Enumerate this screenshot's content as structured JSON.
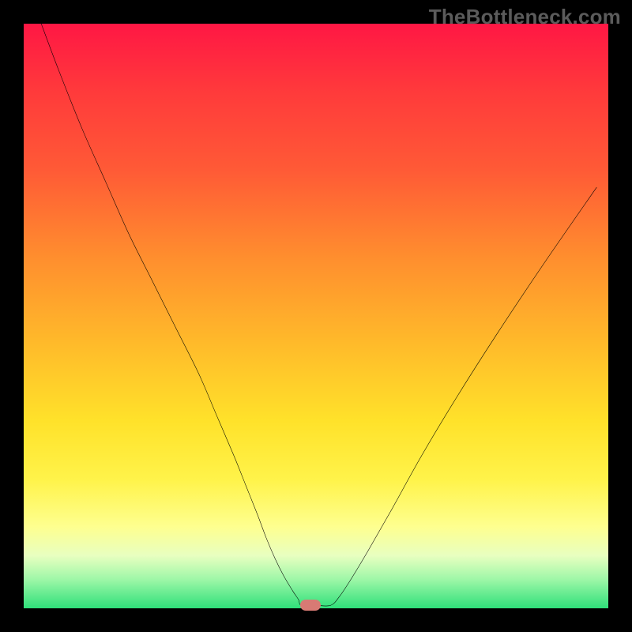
{
  "watermark": "TheBottleneck.com",
  "colors": {
    "frame": "#000000",
    "line": "#000000",
    "marker": "#d87a74",
    "watermark_text": "#5b5b5b"
  },
  "gradient_stops": [
    {
      "pos": 0.0,
      "hex": "#ff1744"
    },
    {
      "pos": 0.12,
      "hex": "#ff3b3b"
    },
    {
      "pos": 0.25,
      "hex": "#ff5a36"
    },
    {
      "pos": 0.4,
      "hex": "#ff8e2e"
    },
    {
      "pos": 0.55,
      "hex": "#ffbb2a"
    },
    {
      "pos": 0.68,
      "hex": "#ffe22a"
    },
    {
      "pos": 0.78,
      "hex": "#fff34a"
    },
    {
      "pos": 0.86,
      "hex": "#feff8f"
    },
    {
      "pos": 0.91,
      "hex": "#e8ffc0"
    },
    {
      "pos": 0.95,
      "hex": "#9ff7a8"
    },
    {
      "pos": 1.0,
      "hex": "#2fe07a"
    }
  ],
  "chart_data": {
    "type": "line",
    "title": "",
    "xlabel": "",
    "ylabel": "",
    "xlim": [
      0,
      100
    ],
    "ylim": [
      0,
      100
    ],
    "grid": false,
    "x": [
      3,
      6,
      10,
      14,
      18,
      22,
      26,
      30,
      33,
      36,
      38,
      40,
      41.5,
      43,
      44.5,
      46,
      47,
      47.5,
      50,
      52.5,
      54,
      56,
      59,
      63,
      68,
      74,
      81,
      89,
      98
    ],
    "values": [
      100,
      92,
      82,
      73,
      64,
      56,
      48,
      40,
      33,
      26,
      21,
      16,
      12,
      8.5,
      5.5,
      3,
      1.5,
      0.5,
      0.5,
      0.5,
      2,
      5,
      10,
      17,
      26,
      36,
      47,
      59,
      72
    ],
    "notch_x": 49,
    "notch_y": 0.5,
    "description": "V-shaped bottleneck curve on rainbow gradient; minimum ~x≈49 near y≈0."
  }
}
